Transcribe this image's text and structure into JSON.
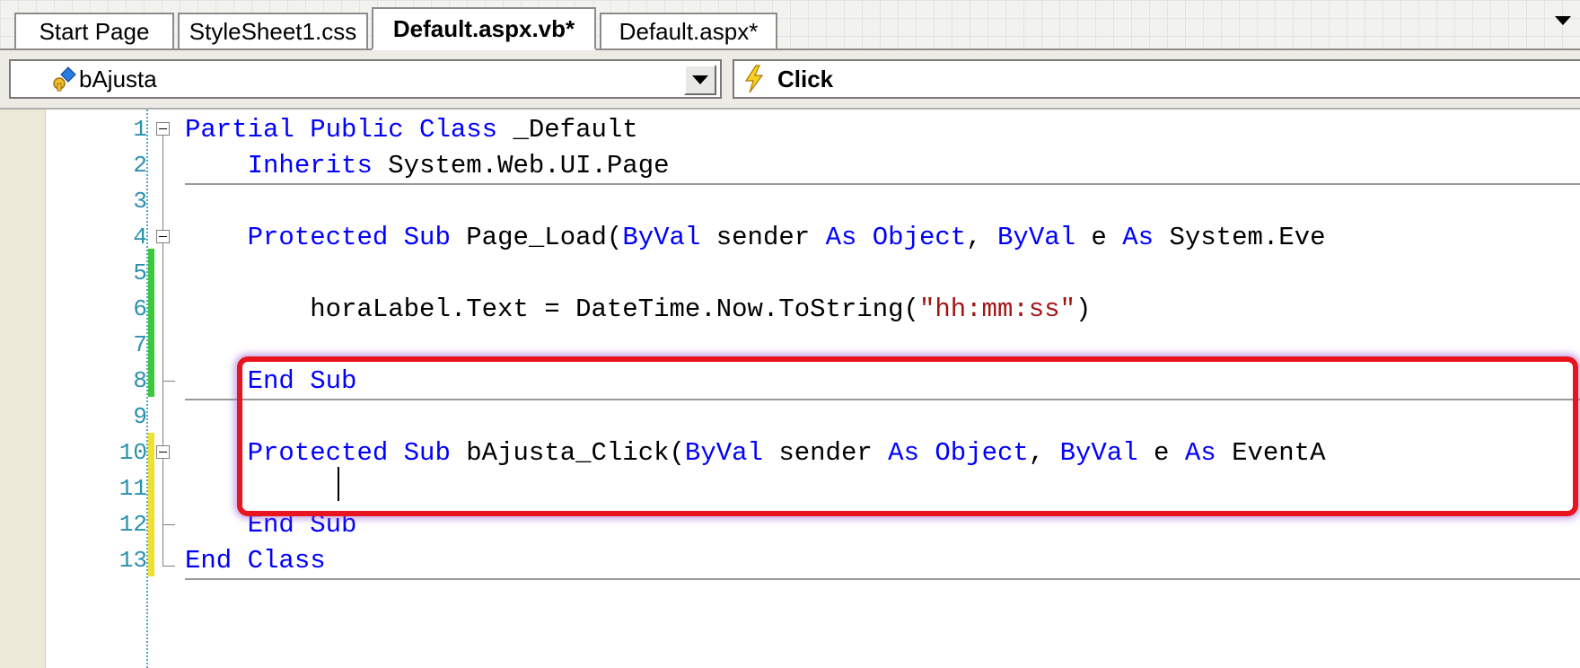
{
  "tabs": [
    {
      "label": "Start Page",
      "active": false
    },
    {
      "label": "StyleSheet1.css",
      "active": false
    },
    {
      "label": "Default.aspx.vb*",
      "active": true
    },
    {
      "label": "Default.aspx*",
      "active": false
    }
  ],
  "navbar": {
    "object_combo": {
      "value": "bAjusta",
      "icon": "field-icon"
    },
    "event_combo": {
      "value": "Click",
      "icon": "lightning-icon"
    }
  },
  "editor": {
    "line_numbers": [
      "1",
      "2",
      "3",
      "4",
      "5",
      "6",
      "7",
      "8",
      "9",
      "10",
      "11",
      "12",
      "13"
    ],
    "lines": [
      [
        {
          "t": "Partial Public Class",
          "k": "kw"
        },
        {
          "t": " _Default"
        }
      ],
      [
        {
          "t": "    "
        },
        {
          "t": "Inherits",
          "k": "kw"
        },
        {
          "t": " System.Web.UI.Page"
        }
      ],
      [],
      [
        {
          "t": "    "
        },
        {
          "t": "Protected Sub",
          "k": "kw"
        },
        {
          "t": " Page_Load("
        },
        {
          "t": "ByVal",
          "k": "kw"
        },
        {
          "t": " sender "
        },
        {
          "t": "As",
          "k": "kw"
        },
        {
          "t": " "
        },
        {
          "t": "Object",
          "k": "kw"
        },
        {
          "t": ", "
        },
        {
          "t": "ByVal",
          "k": "kw"
        },
        {
          "t": " e "
        },
        {
          "t": "As",
          "k": "kw"
        },
        {
          "t": " System.Eve"
        }
      ],
      [],
      [
        {
          "t": "        horaLabel.Text = DateTime.Now.ToString("
        },
        {
          "t": "\"hh:mm:ss\"",
          "k": "str"
        },
        {
          "t": ")"
        }
      ],
      [],
      [
        {
          "t": "    "
        },
        {
          "t": "End Sub",
          "k": "kw"
        }
      ],
      [],
      [
        {
          "t": "    "
        },
        {
          "t": "Protected Sub",
          "k": "kw"
        },
        {
          "t": " bAjusta_Click("
        },
        {
          "t": "ByVal",
          "k": "kw"
        },
        {
          "t": " sender "
        },
        {
          "t": "As",
          "k": "kw"
        },
        {
          "t": " "
        },
        {
          "t": "Object",
          "k": "kw"
        },
        {
          "t": ", "
        },
        {
          "t": "ByVal",
          "k": "kw"
        },
        {
          "t": " e "
        },
        {
          "t": "As",
          "k": "kw"
        },
        {
          "t": " EventA"
        }
      ],
      [],
      [
        {
          "t": "    "
        },
        {
          "t": "End Sub",
          "k": "kw"
        }
      ],
      [
        {
          "t": "End Class",
          "k": "kw"
        }
      ]
    ]
  },
  "colors": {
    "keyword": "#0000ff",
    "string": "#a31515",
    "line_number": "#2b91af",
    "saved_change": "#3cc83c",
    "unsaved_change": "#f0e030",
    "highlight": "#e8141e"
  }
}
